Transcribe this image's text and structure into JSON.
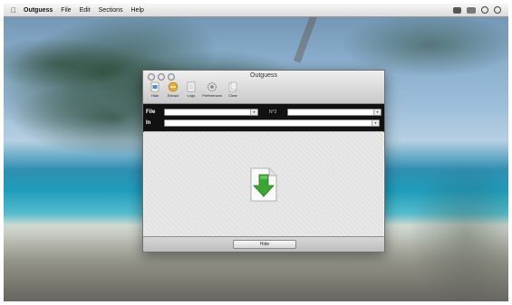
{
  "menubar": {
    "app_name": "Outguess",
    "items": [
      "File",
      "Edit",
      "Sections",
      "Help"
    ]
  },
  "window": {
    "title": "Outguess",
    "toolbar": [
      {
        "label": "Hide",
        "icon": "hide-icon"
      },
      {
        "label": "Extract",
        "icon": "extract-icon"
      },
      {
        "label": "Logs",
        "icon": "logs-icon"
      },
      {
        "label": "Preferences",
        "icon": "preferences-icon"
      },
      {
        "label": "Clear",
        "icon": "clear-icon"
      }
    ],
    "form": {
      "file_label": "File",
      "n2_label": "N°2",
      "in_label": "In"
    },
    "hide_button": "Hide"
  },
  "colors": {
    "accent_green": "#3aa535",
    "toolbar_bg": "#111111"
  }
}
